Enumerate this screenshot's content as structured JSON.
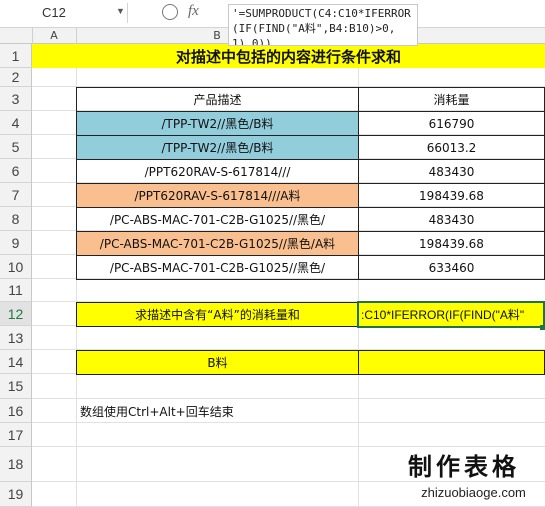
{
  "name_box": {
    "value": "C12"
  },
  "formula_bar": {
    "fx_label": "fx",
    "formula": "'=SUMPRODUCT(C4:C10*IFERROR(IF(FIND(\"A料\",B4:B10)>0,1),0))"
  },
  "columns": [
    "A",
    "B"
  ],
  "rows": [
    "1",
    "2",
    "3",
    "4",
    "5",
    "6",
    "7",
    "8",
    "9",
    "10",
    "11",
    "12",
    "13",
    "14",
    "15",
    "16",
    "17",
    "18",
    "19"
  ],
  "sheet": {
    "title": "对描述中包括的内容进行条件求和",
    "headers": {
      "desc": "产品描述",
      "consumption": "消耗量"
    },
    "items": [
      {
        "desc": "/TPP-TW2//黑色/B料",
        "value": "616790"
      },
      {
        "desc": "/TPP-TW2//黑色/B料",
        "value": "66013.2"
      },
      {
        "desc": "/PPT620RAV-S-617814///",
        "value": "483430"
      },
      {
        "desc": "/PPT620RAV-S-617814///A料",
        "value": "198439.68"
      },
      {
        "desc": "/PC-ABS-MAC-701-C2B-G1025//黑色/",
        "value": "483430"
      },
      {
        "desc": "/PC-ABS-MAC-701-C2B-G1025//黑色/A料",
        "value": "198439.68"
      },
      {
        "desc": "/PC-ABS-MAC-701-C2B-G1025//黑色/",
        "value": "633460"
      }
    ],
    "query_label": "求描述中含有“A料”的消耗量和",
    "query_formula_display": ":C10*IFERROR(IF(FIND(\"A料\"",
    "b_label": "B料",
    "b_value": "",
    "note": "数组使用Ctrl+Alt+回车结束"
  },
  "watermark": {
    "title": "制作表格",
    "url": "zhizuobiaoge.com"
  },
  "colors": {
    "title_bg": "#ffff00",
    "blue_fill": "#92cddc",
    "orange_fill": "#fabf8f",
    "selection": "#217346"
  }
}
